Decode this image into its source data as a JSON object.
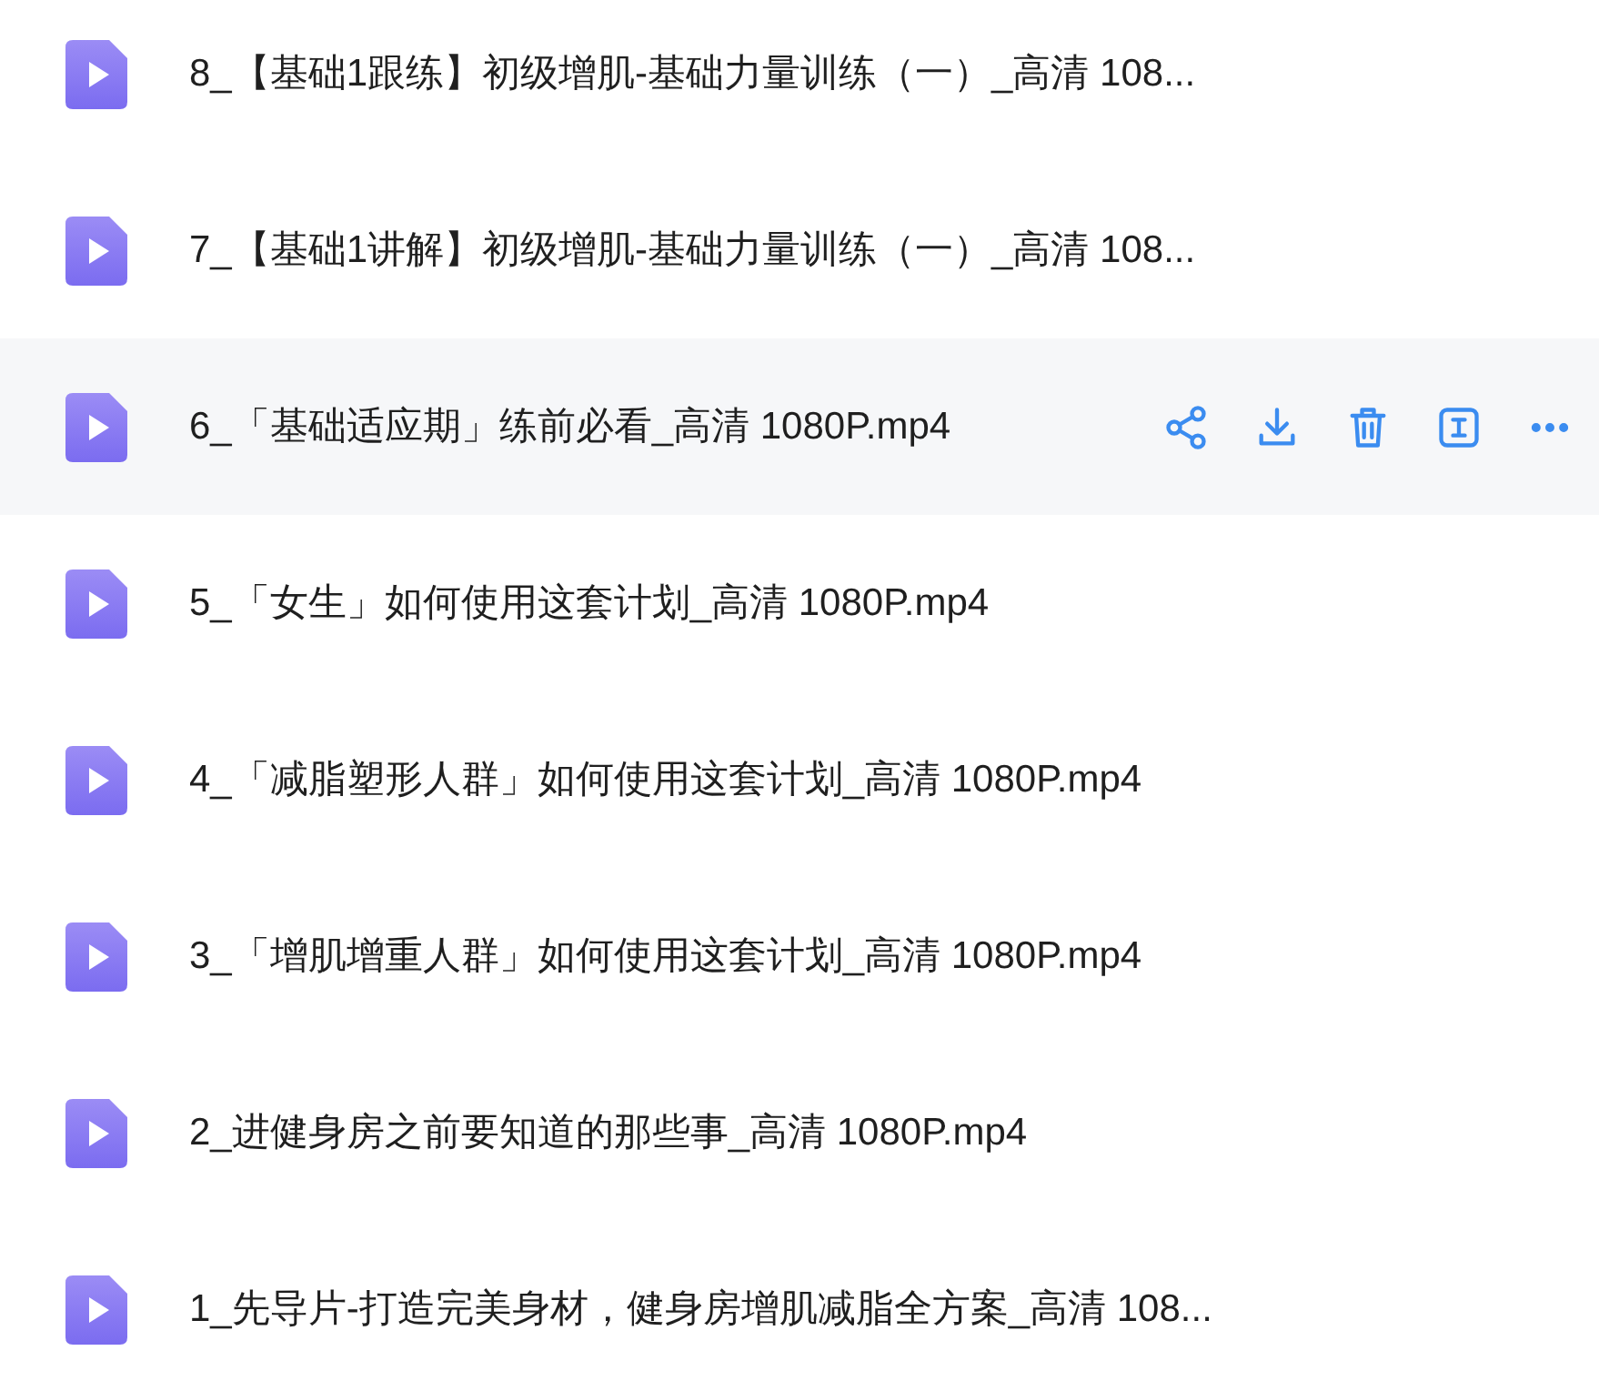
{
  "files": [
    {
      "name": "8_【基础1跟练】初级增肌-基础力量训练（一）_高清 108...",
      "hovered": false
    },
    {
      "name": "7_【基础1讲解】初级增肌-基础力量训练（一）_高清 108...",
      "hovered": false
    },
    {
      "name": "6_「基础适应期」练前必看_高清 1080P.mp4",
      "hovered": true
    },
    {
      "name": "5_「女生」如何使用这套计划_高清 1080P.mp4",
      "hovered": false
    },
    {
      "name": "4_「减脂塑形人群」如何使用这套计划_高清 1080P.mp4",
      "hovered": false
    },
    {
      "name": "3_「增肌增重人群」如何使用这套计划_高清 1080P.mp4",
      "hovered": false
    },
    {
      "name": "2_进健身房之前要知道的那些事_高清 1080P.mp4",
      "hovered": false
    },
    {
      "name": "1_先导片-打造完美身材，健身房增肌减脂全方案_高清 108...",
      "hovered": false
    }
  ]
}
